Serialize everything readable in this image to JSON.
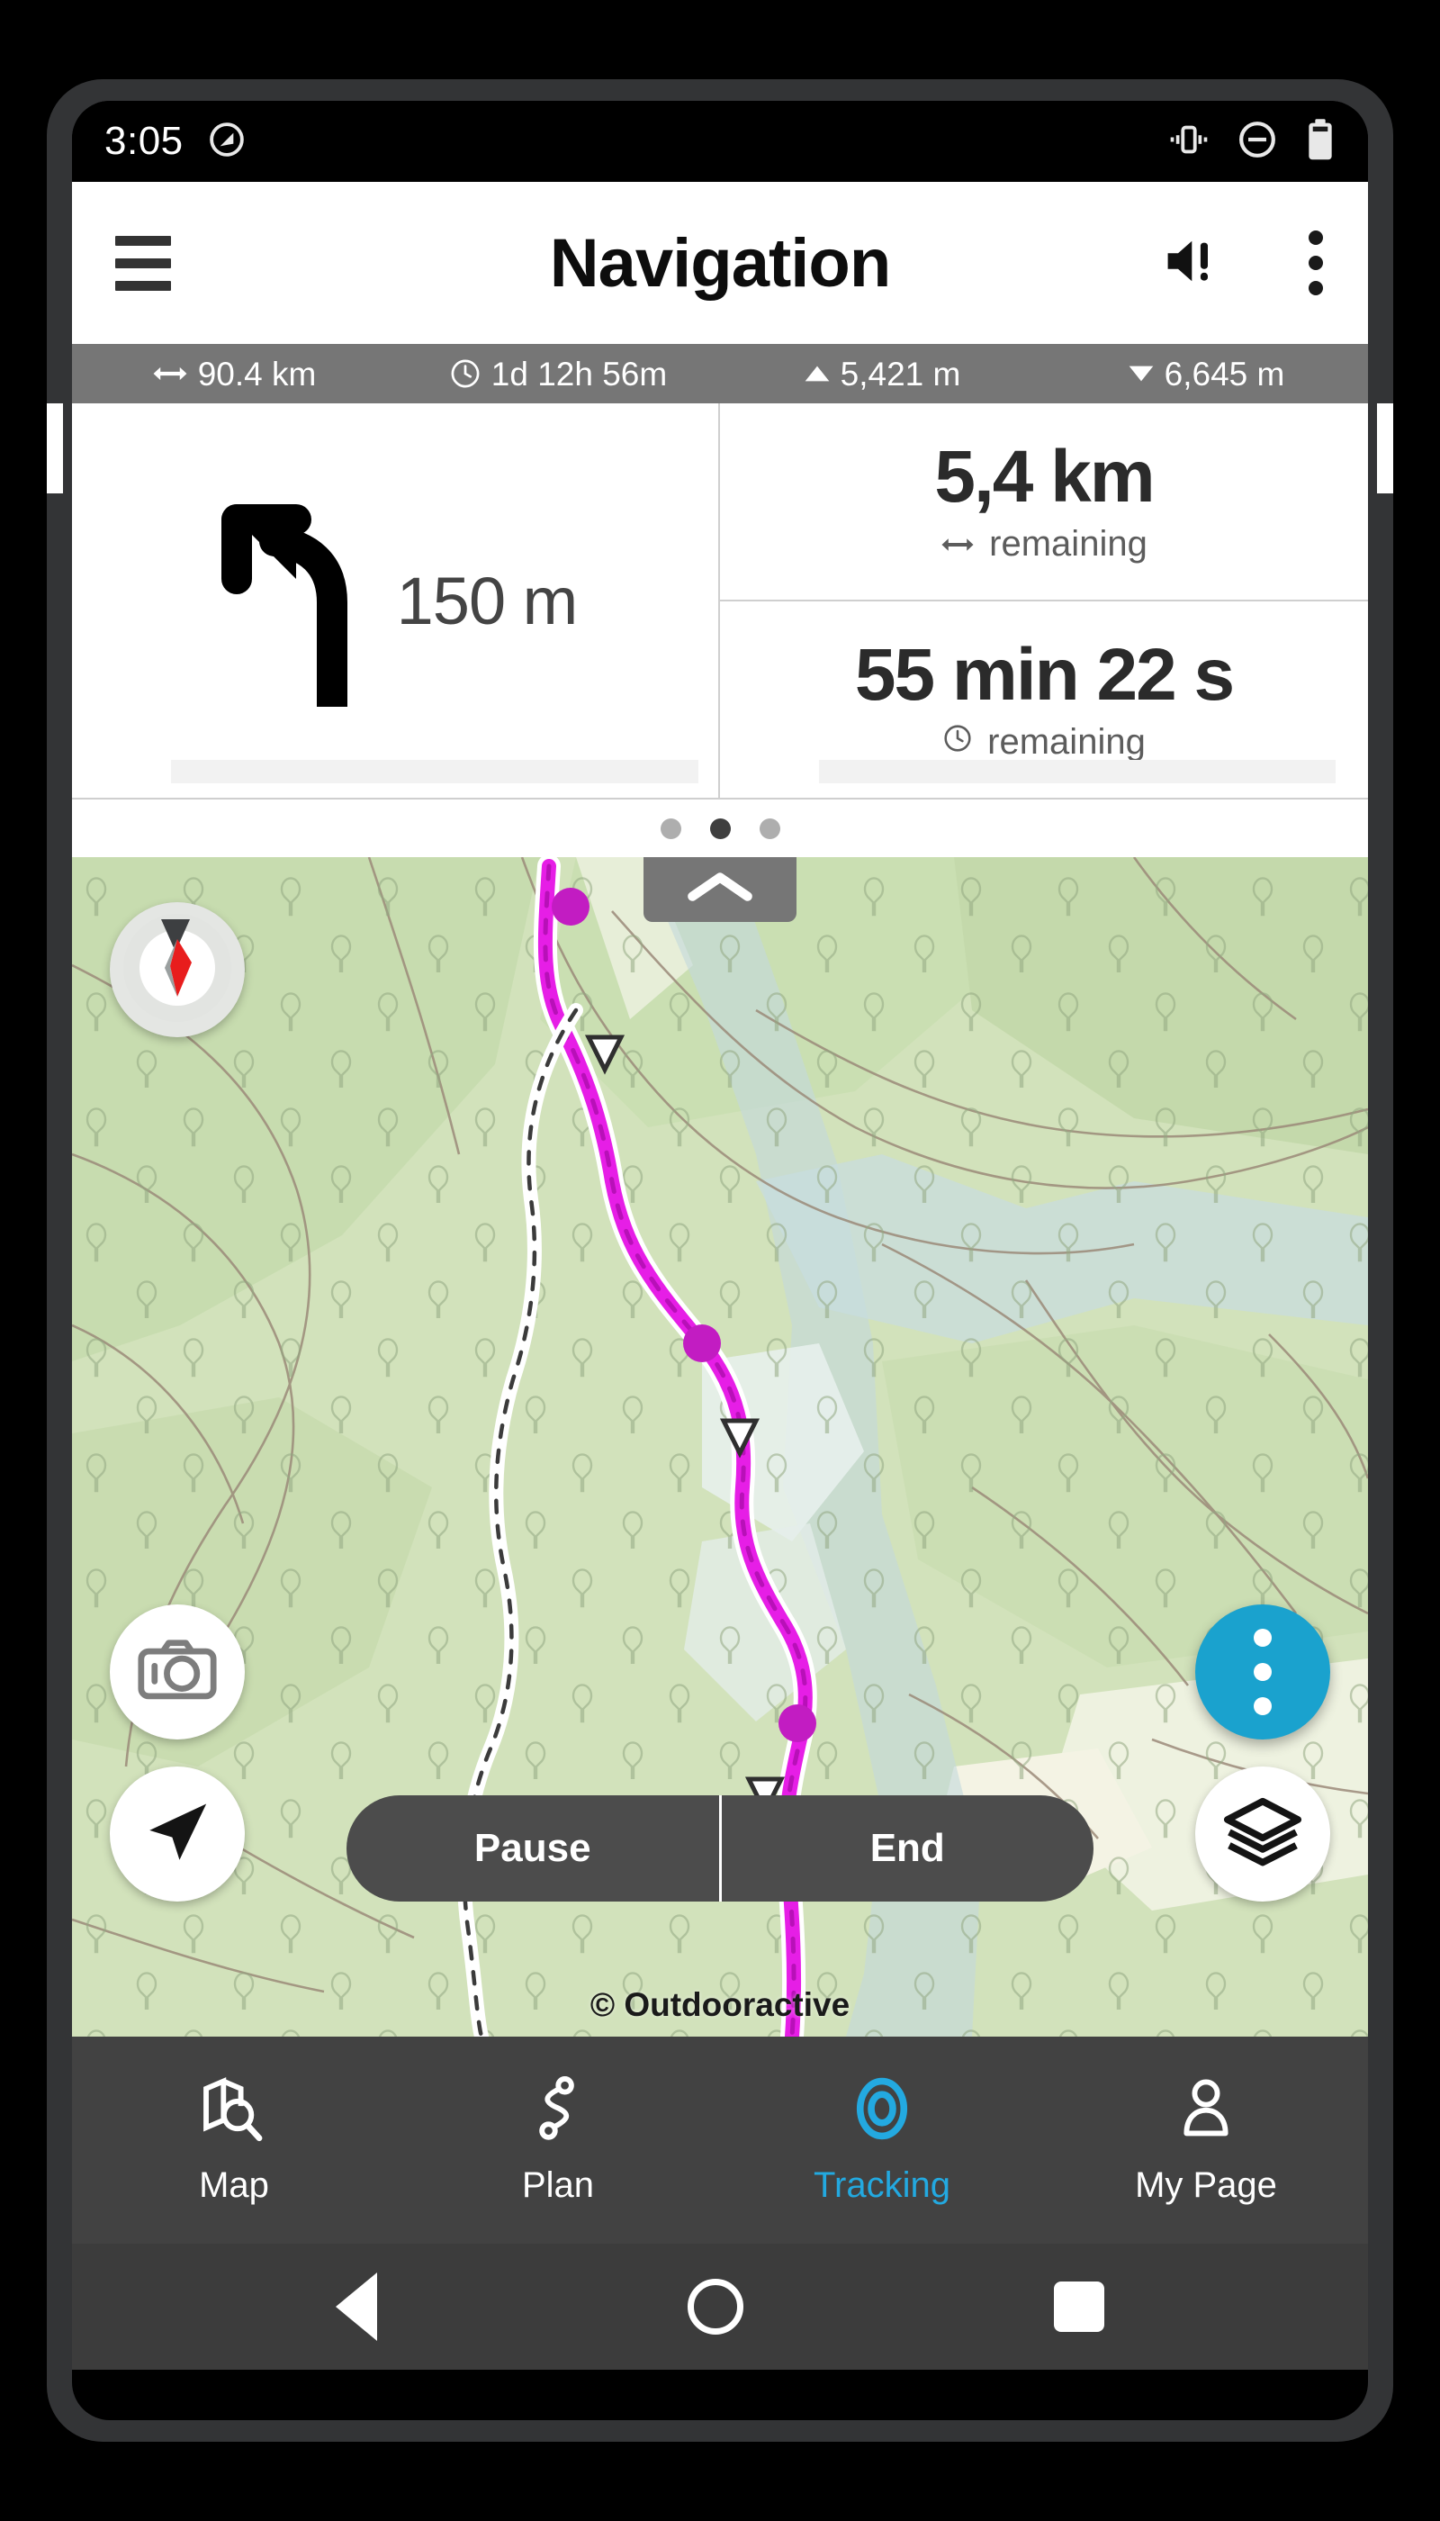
{
  "status_bar": {
    "time": "3:05",
    "icons": [
      "circle-slash-icon",
      "vibrate-icon",
      "do-not-disturb-icon",
      "battery-icon"
    ]
  },
  "app_bar": {
    "menu_icon": "hamburger-menu-icon",
    "title": "Navigation",
    "volume_icon": "volume-alert-icon",
    "overflow_icon": "kebab-menu-icon"
  },
  "stats": [
    {
      "icon": "distance-icon",
      "glyph": "↔",
      "value": "90.4 km"
    },
    {
      "icon": "clock-icon",
      "glyph": "◷",
      "value": "1d 12h 56m"
    },
    {
      "icon": "ascent-icon",
      "glyph": "▲",
      "value": "5,421 m"
    },
    {
      "icon": "descent-icon",
      "glyph": "▼",
      "value": "6,645 m"
    }
  ],
  "turn_panel": {
    "maneuver_icon": "turn-left-arrow-icon",
    "distance": "150 m",
    "remaining_distance": {
      "value": "5,4 km",
      "glyph": "↔",
      "label": "remaining"
    },
    "remaining_time": {
      "value": "55 min 22 s",
      "glyph": "◷",
      "label": "remaining"
    }
  },
  "pager": {
    "pages": 3,
    "active_index": 1
  },
  "map": {
    "collapse_icon": "chevron-up-icon",
    "compass_icon": "compass-icon",
    "camera_icon": "camera-icon",
    "locate_icon": "navigation-arrow-icon",
    "layers_icon": "map-layers-icon",
    "fab_icon": "kebab-menu-icon",
    "attribution": "© Outdooractive",
    "actions": [
      {
        "label": "Pause",
        "name": "pause-button"
      },
      {
        "label": "End",
        "name": "end-button"
      }
    ]
  },
  "bottom_nav": {
    "active": "Tracking",
    "items": [
      {
        "label": "Map",
        "icon": "map-search-icon",
        "name": "nav-map"
      },
      {
        "label": "Plan",
        "icon": "route-plan-icon",
        "name": "nav-plan"
      },
      {
        "label": "Tracking",
        "icon": "tracking-target-icon",
        "name": "nav-tracking"
      },
      {
        "label": "My Page",
        "icon": "user-profile-icon",
        "name": "nav-my-page"
      }
    ]
  },
  "android_nav": {
    "back": "back-button",
    "home": "home-button",
    "recents": "recents-button"
  },
  "colors": {
    "accent": "#1aa2ce",
    "nav_active": "#23a9e0",
    "stats_bar": "#767676",
    "bottom_nav_bg": "#424242",
    "route": "#e61ee6"
  }
}
